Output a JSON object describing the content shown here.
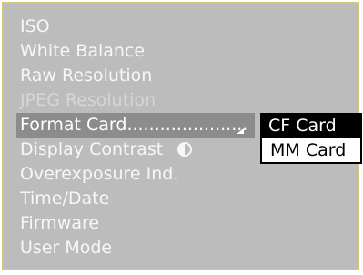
{
  "menu": {
    "items": [
      {
        "label": "ISO"
      },
      {
        "label": "White Balance"
      },
      {
        "label": "Raw Resolution"
      },
      {
        "label": "JPEG Resolution"
      },
      {
        "label": "Format Card......................"
      },
      {
        "label": "Display Contrast"
      },
      {
        "label": "Overexposure Ind."
      },
      {
        "label": "Time/Date"
      },
      {
        "label": "Firmware"
      },
      {
        "label": "User Mode"
      }
    ]
  },
  "submenu": {
    "items": [
      {
        "label": "CF Card"
      },
      {
        "label": "MM Card"
      }
    ]
  },
  "icons": {
    "display_contrast": "contrast-icon",
    "format_card": "submenu-arrow-icon"
  }
}
